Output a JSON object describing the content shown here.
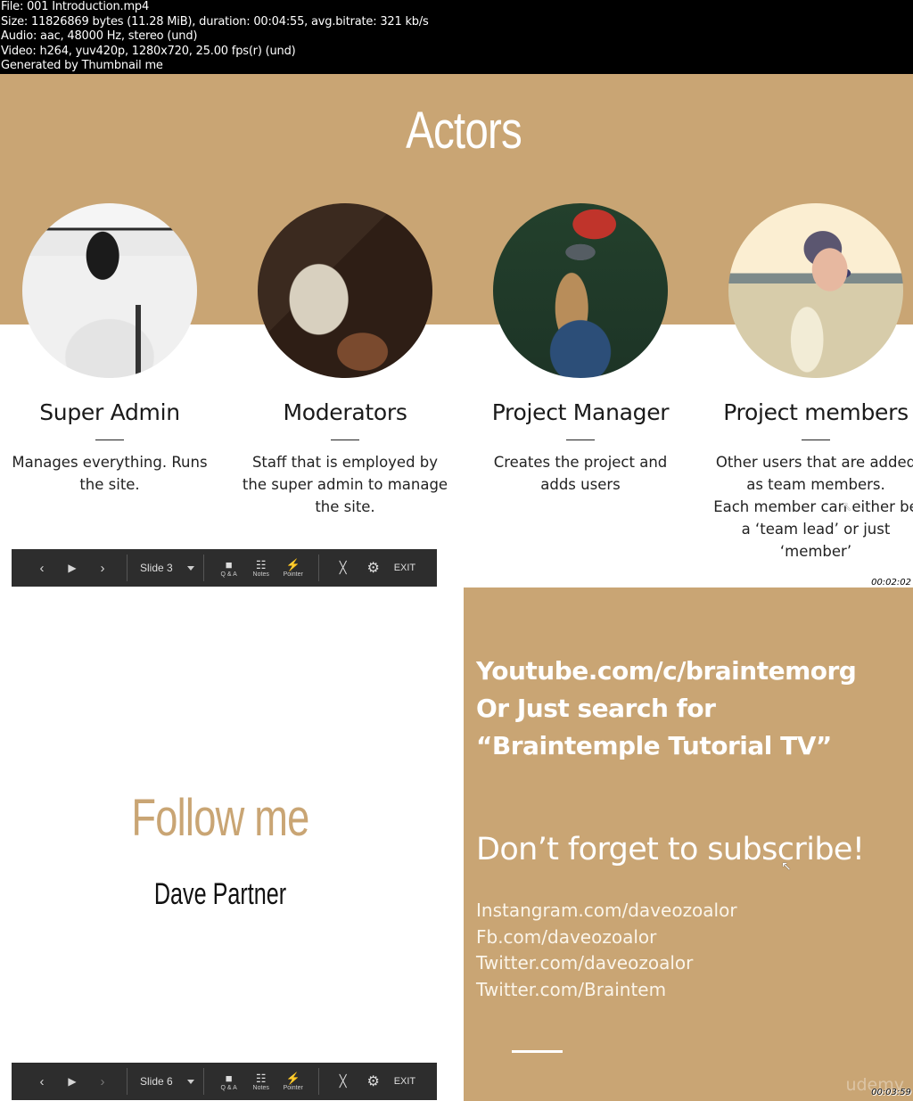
{
  "file_info": {
    "lines": [
      "File: 001 Introduction.mp4",
      "Size: 11826869 bytes (11.28 MiB), duration: 00:04:55, avg.bitrate: 321 kb/s",
      "Audio: aac, 48000 Hz, stereo (und)",
      "Video: h264, yuv420p, 1280x720, 25.00 fps(r) (und)",
      "Generated by Thumbnail me"
    ]
  },
  "frame1": {
    "title": "Actors",
    "timestamp": "00:02:02",
    "actors": [
      {
        "name": "Super Admin",
        "desc": [
          "Manages everything. Runs",
          "the site."
        ],
        "photo": "woman-ponytail-photo"
      },
      {
        "name": "Moderators",
        "desc": [
          "Staff that is employed by",
          "the super admin to manage",
          "the site."
        ],
        "photo": "man-working-photo"
      },
      {
        "name": "Project Manager",
        "desc": [
          "Creates the project and",
          "adds users"
        ],
        "photo": "woman-camera-photo"
      },
      {
        "name": "Project members",
        "desc": [
          "Other users that are added",
          "as team members.",
          "Each member can either be",
          "a ‘team lead’ or just",
          "‘member’"
        ],
        "photo": "woman-flowers-photo"
      }
    ],
    "toolbar": {
      "slide_label": "Slide 3",
      "qa_label": "Q & A",
      "notes_label": "Notes",
      "pointer_label": "Pointer",
      "exit_label": "EXIT"
    }
  },
  "frame2": {
    "follow_title": "Follow me",
    "author": "Dave Partner",
    "youtube_lines": [
      "Youtube.com/c/braintemorg",
      "Or Just search for",
      "“Braintemple Tutorial TV”"
    ],
    "subscribe": "Don’t forget to subscribe!",
    "social_links": [
      "Instangram.com/daveozoalor",
      "Fb.com/daveozoalor",
      "Twitter.com/daveozoalor",
      "Twitter.com/Braintem"
    ],
    "watermark": "udemy",
    "timestamp": "00:03:59",
    "toolbar": {
      "slide_label": "Slide 6",
      "qa_label": "Q & A",
      "notes_label": "Notes",
      "pointer_label": "Pointer",
      "exit_label": "EXIT"
    }
  },
  "colors": {
    "accent": "#c9a574",
    "toolbar_bg": "#2d2d2d"
  }
}
